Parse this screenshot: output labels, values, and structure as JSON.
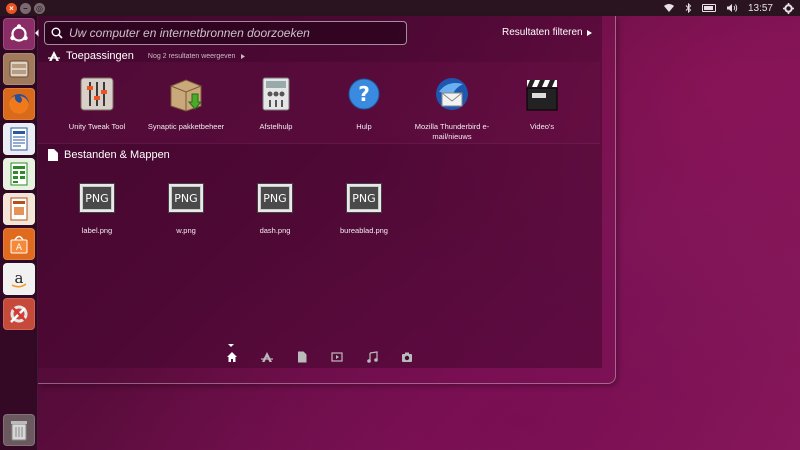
{
  "top_panel": {
    "clock": "13:57",
    "icons": [
      "close-icon",
      "minimize-icon",
      "ubuntu-logo-icon",
      "wifi-icon",
      "bluetooth-icon",
      "battery-icon",
      "volume-icon",
      "gear-icon"
    ]
  },
  "launcher": {
    "items": [
      {
        "name": "dash-home",
        "icon": "ubuntu-logo-icon"
      },
      {
        "name": "files",
        "icon": "file-cabinet-icon"
      },
      {
        "name": "firefox",
        "icon": "firefox-icon"
      },
      {
        "name": "libreoffice-writer",
        "icon": "writer-icon"
      },
      {
        "name": "libreoffice-calc",
        "icon": "calc-icon"
      },
      {
        "name": "libreoffice-impress",
        "icon": "impress-icon"
      },
      {
        "name": "software-center",
        "icon": "shopping-bag-icon"
      },
      {
        "name": "amazon",
        "icon": "amazon-icon"
      },
      {
        "name": "system-settings",
        "icon": "tools-icon"
      },
      {
        "name": "trash",
        "icon": "trash-icon"
      }
    ]
  },
  "search": {
    "placeholder": "Uw computer en internetbronnen doorzoeken"
  },
  "filter": {
    "label": "Resultaten filteren"
  },
  "sections": {
    "apps": {
      "title": "Toepassingen",
      "more": "Nog 2 resultaten weergeven"
    },
    "files": {
      "title": "Bestanden & Mappen"
    }
  },
  "apps": [
    {
      "label": "Unity Tweak Tool",
      "icon": "tweak-sliders-icon"
    },
    {
      "label": "Synaptic pakketbeheer",
      "icon": "package-box-icon"
    },
    {
      "label": "Afstelhulp",
      "icon": "adjust-tool-icon"
    },
    {
      "label": "Hulp",
      "icon": "help-icon"
    },
    {
      "label": "Mozilla Thunderbird e-mail/nieuws",
      "icon": "thunderbird-icon"
    },
    {
      "label": "Video's",
      "icon": "clapperboard-icon"
    }
  ],
  "files": [
    {
      "label": "label.png",
      "badge": "PNG"
    },
    {
      "label": "w.png",
      "badge": "PNG"
    },
    {
      "label": "dash.png",
      "badge": "PNG"
    },
    {
      "label": "bureablad.png",
      "badge": "PNG"
    }
  ],
  "lenses": [
    "home-icon",
    "applications-icon",
    "files-icon",
    "video-icon",
    "music-icon",
    "photos-icon"
  ],
  "colors": {
    "accent": "#e95420",
    "panel": "#2a1420",
    "background": "#5a0c3c"
  }
}
